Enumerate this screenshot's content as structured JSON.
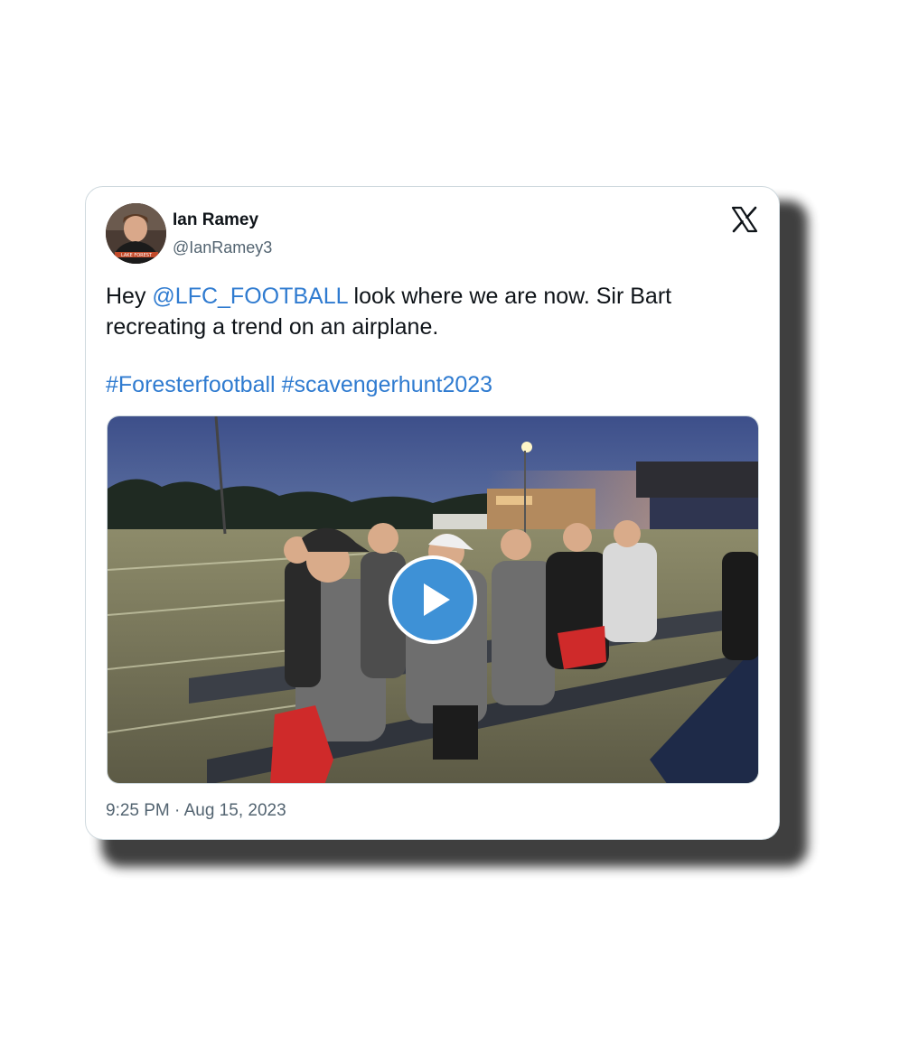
{
  "tweet": {
    "author_name": "Ian Ramey",
    "author_handle": "@IanRamey3",
    "text_prefix": "Hey ",
    "mention": "@LFC_FOOTBALL",
    "text_rest_line1": " look where we are now. Sir Bart",
    "text_line2": "recreating a trend on an airplane.",
    "hashtags": [
      "#Foresterfootball",
      "#scavengerhunt2023"
    ],
    "timestamp": "9:25 PM · Aug 15, 2023",
    "avatar_jersey_text": "LAKE FOREST"
  },
  "icons": {
    "platform": "x-logo-icon",
    "media_control": "play-icon"
  },
  "colors": {
    "link": "#2f7bd0",
    "play_button": "#3e91d6",
    "text_primary": "#0f1419",
    "text_secondary": "#536471"
  }
}
